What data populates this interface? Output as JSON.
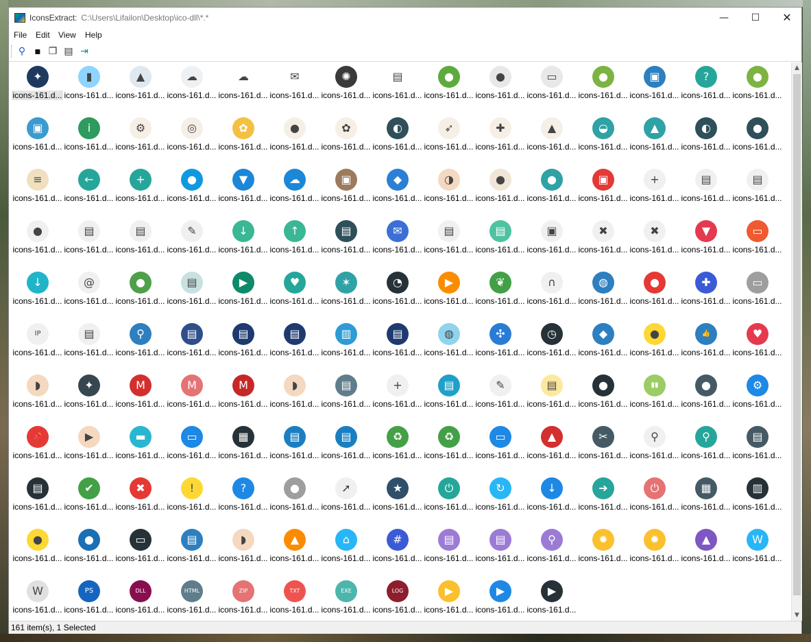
{
  "window": {
    "app_name": "IconsExtract:",
    "path": "C:\\Users\\Lifailon\\Desktop\\ico-dll\\*.*",
    "minimize": "—",
    "maximize": "☐",
    "close": "✕"
  },
  "menu": [
    "File",
    "Edit",
    "View",
    "Help"
  ],
  "toolbar": [
    "search-icon",
    "save-icon",
    "copy-icon",
    "properties-icon",
    "exit-icon"
  ],
  "icon_label": "icons-161.d...",
  "items": [
    [
      "#1e3a5f",
      "#8fd3ff",
      "#dfe7ef",
      "#eef1f3",
      "#ffffff",
      "#ffffff",
      "#3a3a3a",
      "#ffffff",
      "#5cab3c",
      "#e8e8e8",
      "#e8e8e8",
      "#7cb342",
      "#2d7fbf",
      "#26a69a",
      "#7cb342"
    ],
    [
      "#3b9bd0",
      "#2e9a5e",
      "#f6efe6",
      "#f6efe6",
      "#f3c042",
      "#f6efe6",
      "#f6efe6",
      "#2f4f5a",
      "#f6efe6",
      "#f6efe6",
      "#f6efe6",
      "#2fa2a6",
      "#2fa2a6",
      "#2f4f5a",
      "#2f4f5a"
    ],
    [
      "#f0e0c0",
      "#26a69a",
      "#26a69a",
      "#0f9ae0",
      "#1b87d6",
      "#1b87d6",
      "#9d7a5d",
      "#2b7fd4",
      "#f4d8c0",
      "#f0e6d8",
      "#2fa2a6",
      "#e53935",
      "#f0f0f0",
      "#f0f0f0",
      "#f0f0f0"
    ],
    [
      "#f0f0f0",
      "#f0f0f0",
      "#f0f0f0",
      "#f0f0f0",
      "#3ab795",
      "#3ab795",
      "#2f4f5a",
      "#3b6fd6",
      "#f0f0f0",
      "#4fc3a1",
      "#f0f0f0",
      "#f0f0f0",
      "#f0f0f0",
      "#e53950",
      "#ef5a30"
    ],
    [
      "#1fb5c9",
      "#f0f0f0",
      "#4fa04a",
      "#c8e0e0",
      "#0e8a6a",
      "#26a69a",
      "#2fa2a6",
      "#263238",
      "#fb8c00",
      "#43a047",
      "#f0f0f0",
      "#2d7fbf",
      "#e53935",
      "#3b5bd6",
      "#9e9e9e"
    ],
    [
      "#f0f0f0",
      "#f0f0f0",
      "#2d7fbf",
      "#2f4f8a",
      "#1e3a6f",
      "#1e3a6f",
      "#2d9bd6",
      "#1e3a6f",
      "#8fd3ef",
      "#2a7bd6",
      "#263238",
      "#2d7fbf",
      "#fdd835",
      "#2d7fbf",
      "#e53950"
    ],
    [
      "#f4d8c0",
      "#37474f",
      "#d32f2f",
      "#e57373",
      "#c62828",
      "#f4d8c0",
      "#607d8b",
      "#f0f0f0",
      "#1fa0c9",
      "#f0f0f0",
      "#fde8a0",
      "#263238",
      "#9ccc65",
      "#455a64",
      "#1e88e5"
    ],
    [
      "#e53935",
      "#f4d8c0",
      "#29b6d0",
      "#1e88e5",
      "#263238",
      "#1a7fc1",
      "#1a7fc1",
      "#43a047",
      "#43a047",
      "#1e88e5",
      "#d32f2f",
      "#455a64",
      "#f0f0f0",
      "#26a69a",
      "#455a64"
    ],
    [
      "#263238",
      "#43a047",
      "#e53935",
      "#fdd835",
      "#1e88e5",
      "#9e9e9e",
      "#f0f0f0",
      "#2f4f6a",
      "#26a69a",
      "#29b6f6",
      "#1e88e5",
      "#26a69a",
      "#e57373",
      "#455a64",
      "#263238"
    ],
    [
      "#fdd835",
      "#1a6fb5",
      "#263238",
      "#2d7fbf",
      "#f4d8c0",
      "#fb8c00",
      "#29b6f6",
      "#3b5bd6",
      "#9c7bd6",
      "#9c7bd6",
      "#9c7bd6",
      "#fbc02d",
      "#fbc02d",
      "#7e57c2",
      "#29b6f6"
    ],
    [
      "#e0e0e0",
      "#1565c0",
      "#880e4f",
      "#607d8b",
      "#e57373",
      "#ef5350",
      "#4db6ac",
      "#8e1e2e",
      "#fbc02d",
      "#1e88e5",
      "#263238"
    ]
  ],
  "glyphs": [
    [
      "✦",
      "▮",
      "▲",
      "☁",
      "☁",
      "✉",
      "✺",
      "▤",
      "●",
      "●",
      "▭",
      "●",
      "▣",
      "?",
      "●"
    ],
    [
      "▣",
      "i",
      "⚙",
      "◎",
      "✿",
      "●",
      "✿",
      "◐",
      "➶",
      "✚",
      "▲",
      "◒",
      "▲",
      "◐",
      "●"
    ],
    [
      "≡",
      "←",
      "+",
      "●",
      "▼",
      "☁",
      "▣",
      "◆",
      "◑",
      "●",
      "●",
      "▣",
      "+",
      "▤",
      "▤"
    ],
    [
      "●",
      "▤",
      "▤",
      "✎",
      "↓",
      "↑",
      "▤",
      "✉",
      "▤",
      "▤",
      "▣",
      "✖",
      "✖",
      "▼",
      "▭"
    ],
    [
      "↓",
      "@",
      "●",
      "▤",
      "▶",
      "♥",
      "✶",
      "◔",
      "▶",
      "❦",
      "∩",
      "◍",
      "●",
      "✚",
      "▭"
    ],
    [
      "IP",
      "▤",
      "⚲",
      "▤",
      "▤",
      "▤",
      "▥",
      "▤",
      "◍",
      "✣",
      "◷",
      "◆",
      "●",
      "👍",
      "♥"
    ],
    [
      "◗",
      "✦",
      "M",
      "M",
      "M",
      "◗",
      "▤",
      "+",
      "▤",
      "✎",
      "▤",
      "●",
      "▮▮",
      "●",
      "⚙"
    ],
    [
      "📌",
      "▶",
      "▬",
      "▭",
      "▦",
      "▤",
      "▤",
      "♻",
      "♻",
      "▭",
      "▲",
      "✂",
      "⚲",
      "⚲",
      "▤"
    ],
    [
      "▤",
      "✔",
      "✖",
      "!",
      "?",
      "●",
      "➚",
      "★",
      "⏻",
      "↻",
      "↓",
      "➔",
      "⏻",
      "▦",
      "▥"
    ],
    [
      "●",
      "●",
      "▭",
      "▤",
      "◗",
      "▲",
      "⌂",
      "#",
      "▤",
      "▤",
      "⚲",
      "✹",
      "✹",
      "▲",
      "W"
    ],
    [
      "W",
      "PS",
      "DLL",
      "HTML",
      "ZIP",
      "TXT",
      "EXE",
      "LOG",
      "▶",
      "▶",
      "▶"
    ]
  ],
  "status": "161 item(s), 1 Selected"
}
